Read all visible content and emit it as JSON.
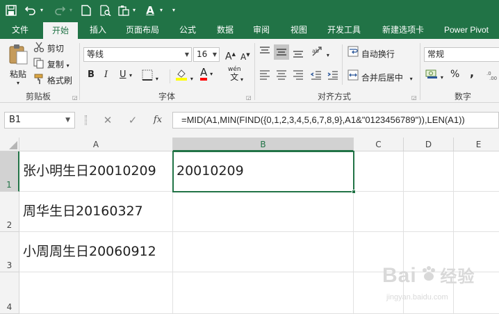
{
  "qat": {
    "undo_caret": "▾",
    "redo_caret": "▾",
    "font_color_letter": "A",
    "customize_caret": "▾"
  },
  "tabs": [
    "文件",
    "开始",
    "插入",
    "页面布局",
    "公式",
    "数据",
    "审阅",
    "视图",
    "开发工具",
    "新建选项卡",
    "Power Pivot"
  ],
  "active_tab_index": 1,
  "ribbon": {
    "clipboard": {
      "paste": "粘贴",
      "cut": "剪切",
      "copy": "复制",
      "format_painter": "格式刷",
      "label": "剪贴板"
    },
    "font": {
      "font_name": "等线",
      "font_size": "16",
      "bold": "B",
      "italic": "I",
      "underline": "U",
      "grow": "A",
      "shrink": "A",
      "font_color": "A",
      "wen": "wén",
      "wen_char": "文",
      "label": "字体"
    },
    "alignment": {
      "wrap_text": "自动换行",
      "merge_center": "合并后居中",
      "label": "对齐方式"
    },
    "number": {
      "format": "常规",
      "percent": "%",
      "comma": ",",
      "label": "数字"
    }
  },
  "formula_bar": {
    "name_box": "B1",
    "fx": "fx",
    "formula": "=MID(A1,MIN(FIND({0,1,2,3,4,5,6,7,8,9},A1&\"0123456789\")),LEN(A1))"
  },
  "sheet": {
    "columns": [
      "A",
      "B",
      "C",
      "D",
      "E"
    ],
    "rows": [
      "1",
      "2",
      "3",
      "4"
    ],
    "cells": {
      "A1": "张小明生日20010209",
      "B1": "20010209",
      "A2": "周华生日20160327",
      "A3": "小周周生日20060912"
    },
    "active_cell": "B1"
  },
  "watermark": {
    "brand": "Bai",
    "brand_suffix": "经验",
    "url": "jingyan.baidu.com"
  },
  "colors": {
    "accent": "#217346",
    "ribbon_bg": "#f3f3f3",
    "header_bg": "#f3f3f3",
    "selected_header_bg": "#d2d2d2"
  }
}
